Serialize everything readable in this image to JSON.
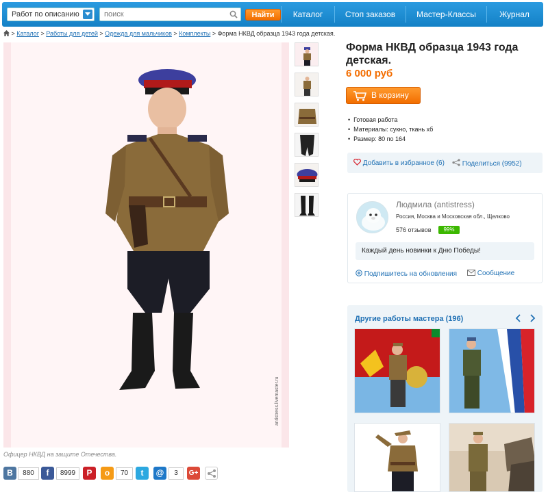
{
  "header": {
    "search_mode": "Работ по описанию",
    "search_placeholder": "поиск",
    "find_label": "Найти",
    "nav": [
      "Каталог",
      "Стоп заказов",
      "Мастер-Классы",
      "Журнал"
    ]
  },
  "breadcrumb": {
    "items": [
      "Каталог",
      "Работы для детей",
      "Одежда для мальчиков",
      "Комплекты"
    ],
    "current": "Форма НКВД образца 1943 года детская."
  },
  "product": {
    "title": "Форма НКВД образца 1943 года детская.",
    "price": "6 000 руб",
    "cart_label": "В корзину",
    "properties": [
      "Готовая работа",
      "Материалы: сукно, ткань хб",
      "Размер: 80 по 164"
    ],
    "favorite_label": "Добавить в избранное (6)",
    "share_label": "Поделиться (9952)",
    "photo_caption": "Офицер НКВД на защите Отечества.",
    "watermark": "antistress.livemaster.ru"
  },
  "share_bar": {
    "vk_count": "880",
    "fb_count": "8999",
    "ok_count": "70",
    "mail_count": "3"
  },
  "seller": {
    "name": "Людмила (antistress)",
    "location": "Россия, Москва и Московская обл., Щелково",
    "reviews": "576 отзывов",
    "rating": "99%",
    "news": "Каждый день новинки к Дню Победы!",
    "subscribe_label": "Подпишитесь на обновления",
    "message_label": "Сообщение"
  },
  "other_works": {
    "title": "Другие работы мастера (196)"
  },
  "colors": {
    "brand_blue": "#1a8dd4",
    "accent_orange": "#f36d00",
    "link_blue": "#2272b5",
    "rating_green": "#3cb800"
  }
}
